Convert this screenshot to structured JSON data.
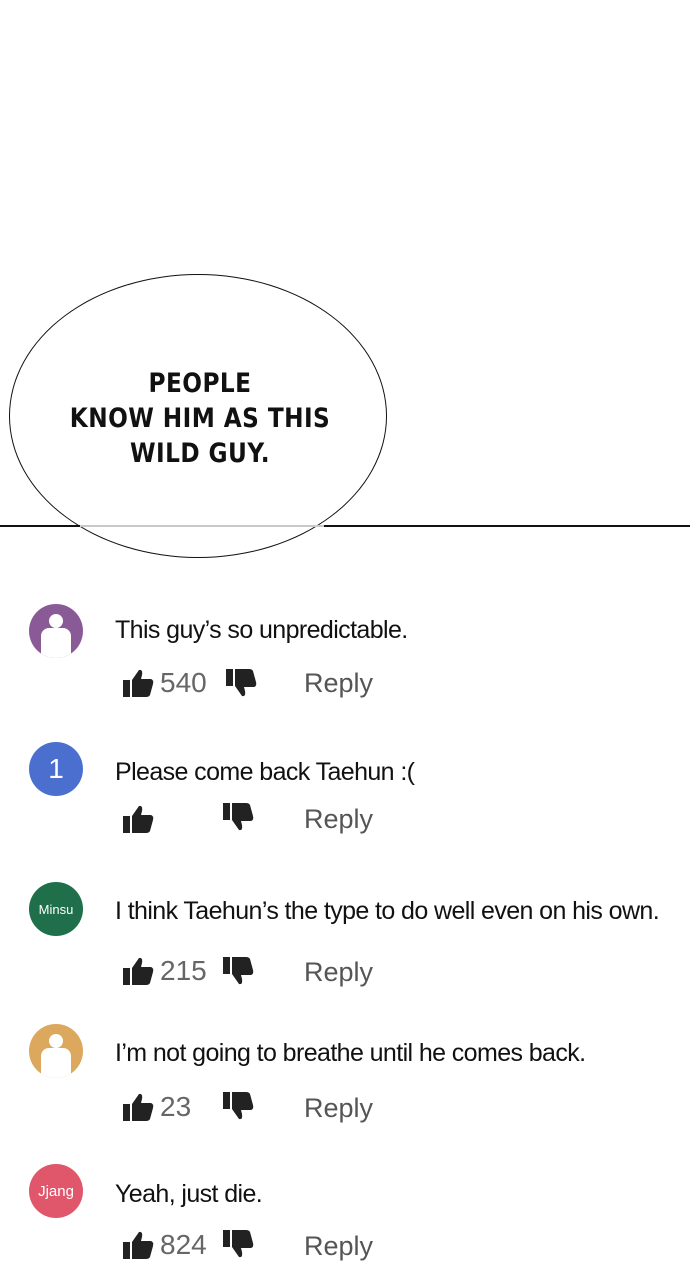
{
  "bubble": {
    "lines": [
      "PEOPLE",
      "KNOW HIM AS THIS",
      "WILD GUY."
    ]
  },
  "comments": [
    {
      "avatar_color": "#8a5a97",
      "avatar_type": "person-icon",
      "avatar_label": "",
      "text": "This guy’s so unpredictable.",
      "likes": "540",
      "reply_label": "Reply"
    },
    {
      "avatar_color": "#4a6fce",
      "avatar_type": "text",
      "avatar_label": "1",
      "text": "Please come back Taehun :(",
      "likes": "",
      "reply_label": "Reply"
    },
    {
      "avatar_color": "#1e6f4a",
      "avatar_type": "text",
      "avatar_label": "Minsu",
      "text": "I think Taehun’s the type to do well even on his own.",
      "likes": "215",
      "reply_label": "Reply"
    },
    {
      "avatar_color": "#dca85e",
      "avatar_type": "person-icon",
      "avatar_label": "",
      "text": "I’m not going to breathe until he comes back.",
      "likes": "23",
      "reply_label": "Reply"
    },
    {
      "avatar_color": "#e0566b",
      "avatar_type": "text",
      "avatar_label": "Jjang",
      "text": "Yeah, just die.",
      "likes": "824",
      "reply_label": "Reply"
    }
  ]
}
